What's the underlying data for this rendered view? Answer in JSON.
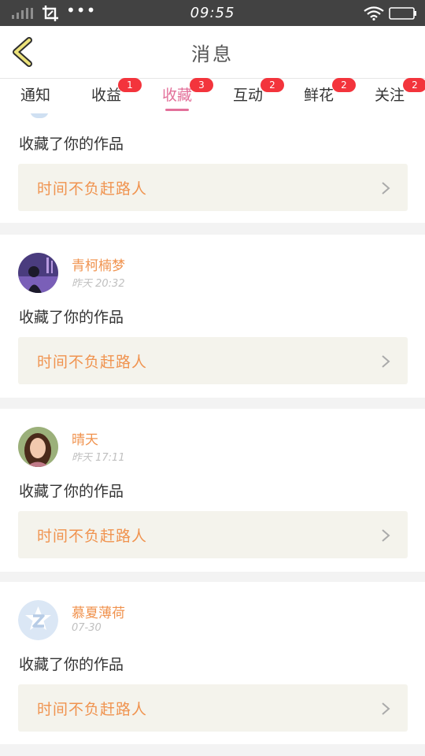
{
  "status_bar": {
    "time": "09:55"
  },
  "header": {
    "title": "消息"
  },
  "tabs": [
    {
      "label": "通知",
      "badge": ""
    },
    {
      "label": "收益",
      "badge": "1"
    },
    {
      "label": "收藏",
      "badge": "3",
      "active": true
    },
    {
      "label": "互动",
      "badge": "2"
    },
    {
      "label": "鲜花",
      "badge": "2"
    },
    {
      "label": "关注",
      "badge": "2"
    }
  ],
  "feed": [
    {
      "user": "",
      "time": "",
      "action": "收藏了你的作品",
      "work": "时间不负赶路人"
    },
    {
      "user": "青柯楠梦",
      "time": "昨天 20:32",
      "action": "收藏了你的作品",
      "work": "时间不负赶路人"
    },
    {
      "user": "晴天",
      "time": "昨天 17:11",
      "action": "收藏了你的作品",
      "work": "时间不负赶路人"
    },
    {
      "user": "慕夏薄荷",
      "time": "07-30",
      "action": "收藏了你的作品",
      "work": "时间不负赶路人"
    }
  ],
  "colors": {
    "accent": "#e3709a",
    "badge": "#f3343c",
    "username": "#f0934f",
    "work_bg": "#f4f3ec"
  },
  "icons": [
    "signal-icon",
    "screenshot-icon",
    "more-icon",
    "wifi-icon",
    "battery-icon",
    "back-icon",
    "chevron-right-icon"
  ]
}
